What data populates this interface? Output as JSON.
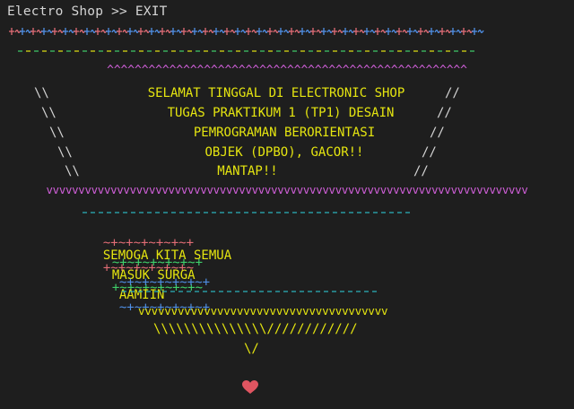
{
  "window": {
    "title": "Electro Shop >> EXIT"
  },
  "colors": {
    "background": "#1e1e1e",
    "text": "#d4d4d4",
    "yellow": "#e5e510",
    "magenta": "#cf5fd8",
    "blue": "#4f8fe5",
    "red": "#e06c75",
    "cyan": "#2bb7c2",
    "green": "#3fcf6a",
    "heart": "#e05561"
  },
  "banner": {
    "top_pattern": "+~+~+~+~+~+~+~+~+~+~+~+~+~+~+~+~+~+~+~+~+~+~+~+~+~+~+~+~+~+~+~+~+~+~+~+~+~+~+~+~+~+~+~+~+~+~+~+~+~+~+~+~+~+~+~+~+",
    "dash_line_1": "- - - - - - - - - - - - - - - - - - - - - - - - - - - - - - - - - - - - - - - - - - - - - - - - - - - - - - -",
    "caret_line": "^^^^^^^^^^^^^^^^^^^^^^^^^^^^^^^^^^^^^^^^^^^^^^^^^^^^",
    "left_slashes": [
      "\\\\",
      "\\\\",
      "\\\\",
      "\\\\",
      "\\\\"
    ],
    "right_slashes": [
      "//",
      "//",
      "//",
      "//",
      "//"
    ],
    "messages": [
      "SELAMAT TINGGAL DI ELECTRONIC SHOP",
      "TUGAS PRAKTIKUM 1 (TP1) DESAIN",
      "PEMROGRAMAN BERORIENTASI",
      "OBJEK (DPBO), GACOR!!",
      "MANTAP!!"
    ],
    "v_line": "vvvvvvvvvvvvvvvvvvvvvvvvvvvvvvvvvvvvvvvvvvvvvvvvvvvvvvvvvvvvvvvvvvvvvvvvvvv",
    "dash_line_2": "- - - - - - - - - - - - - - - - - - - - - - - - - - - - - - - - - - - - - - - -",
    "wish": [
      {
        "left": "~+~+~+~+~+~+",
        "text": "SEMOGA KITA SEMUA",
        "right": "+~+~+~+~+~+~"
      },
      {
        "left": "~+~+~+~+~+~+",
        "text": "MASUK SURGA",
        "right": "+~+~+~+~+~+~"
      },
      {
        "left": "~+~+~+~+~+~+",
        "text": "AAMIIN",
        "right": "~+~+~+~+~+~+"
      }
    ],
    "dash_line_3": "- - - - - - - - - - - - - - - - - - - - - - - - - - - - - - - - -",
    "v_line_2": "vvvvvvvvvvvvvvvvvvvvvvvvvvvvvvvvvvvvvv",
    "slash_funnel": "\\\\\\\\\\\\\\\\\\\\\\\\\\\\\\////////////",
    "tip": "\\/",
    "heart_icon": "heart"
  }
}
